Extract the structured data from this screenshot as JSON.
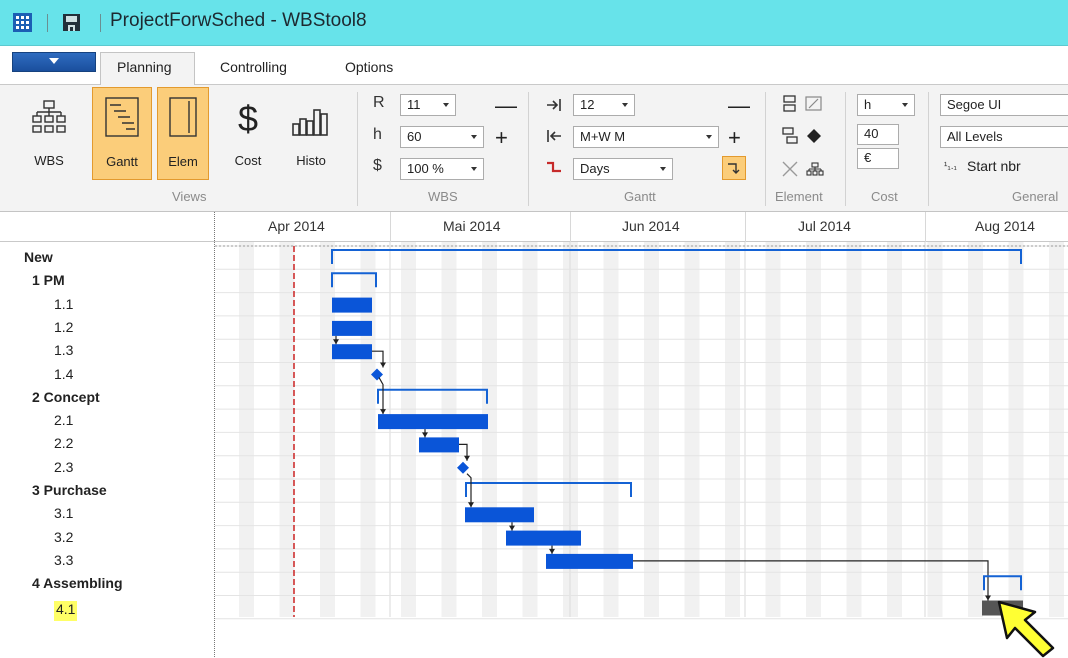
{
  "window": {
    "title": "ProjectForwSched - WBStool8"
  },
  "tabs": [
    {
      "label": "Planning",
      "active": true
    },
    {
      "label": "Controlling",
      "active": false
    },
    {
      "label": "Options",
      "active": false
    }
  ],
  "ribbon": {
    "views": {
      "group_label": "Views",
      "buttons": [
        {
          "label": "WBS",
          "icon": "wbs-tree-icon",
          "active": false
        },
        {
          "label": "Gantt",
          "icon": "gantt-icon",
          "active": true
        },
        {
          "label": "Elem",
          "icon": "element-panel-icon",
          "active": true
        },
        {
          "label": "Cost",
          "icon": "dollar-icon",
          "active": false
        },
        {
          "label": "Histo",
          "icon": "histogram-icon",
          "active": false
        }
      ]
    },
    "wbs": {
      "group_label": "WBS",
      "r_label": "R",
      "r_value": "11",
      "h_label": "h",
      "h_value": "60",
      "dollar_label": "$",
      "zoom_value": "100 %",
      "minus": "—",
      "plus": "+"
    },
    "gantt": {
      "group_label": "Gantt",
      "indent_value": "12",
      "timescale_value": "M+W M",
      "unit_value": "Days",
      "minus": "—",
      "plus": "+"
    },
    "element": {
      "group_label": "Element"
    },
    "cost": {
      "group_label": "Cost",
      "unit_value": "h",
      "amount_value": "40",
      "currency_value": "€"
    },
    "general": {
      "group_label": "General",
      "font_value": "Segoe UI",
      "levels_value": "All Levels",
      "start_nbr_label": "Start nbr",
      "start_nbr_glyph": "¹₁.₁"
    }
  },
  "gantt": {
    "months": [
      "Apr 2014",
      "Mai 2014",
      "Jun 2014",
      "Jul 2014",
      "Aug 2014"
    ],
    "rows": [
      {
        "label": "New",
        "level": 0
      },
      {
        "label": "1 PM",
        "level": 1
      },
      {
        "label": "1.1",
        "level": 2
      },
      {
        "label": "1.2",
        "level": 2
      },
      {
        "label": "1.3",
        "level": 2
      },
      {
        "label": "1.4",
        "level": 2
      },
      {
        "label": "2 Concept",
        "level": 1
      },
      {
        "label": "2.1",
        "level": 2
      },
      {
        "label": "2.2",
        "level": 2
      },
      {
        "label": "2.3",
        "level": 2
      },
      {
        "label": "3 Purchase",
        "level": 1
      },
      {
        "label": "3.1",
        "level": 2
      },
      {
        "label": "3.2",
        "level": 2
      },
      {
        "label": "3.3",
        "level": 2
      },
      {
        "label": "4 Assembling",
        "level": 1
      },
      {
        "label": "4.1",
        "level": 2,
        "highlight": true
      }
    ],
    "colors": {
      "task": "#0a55d8",
      "summary": "#1462d4",
      "selected": "#555555",
      "today": "#cc2222",
      "highlight": "#ffff66"
    }
  }
}
